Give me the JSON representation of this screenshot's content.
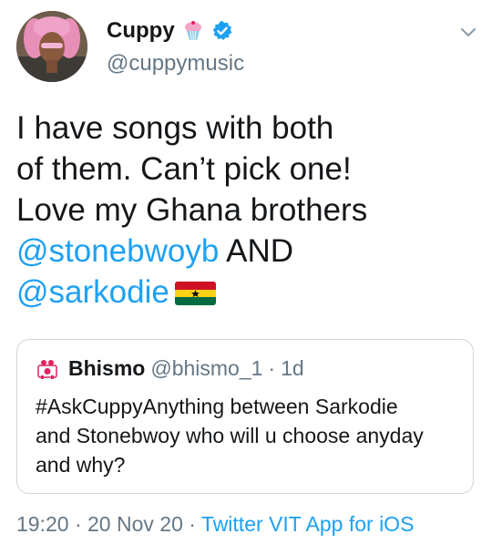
{
  "author": {
    "display_name": "Cuppy",
    "handle": "@cuppymusic",
    "badge_icon": "cupcake-icon",
    "verified_icon": "verified-badge-icon",
    "verified_color": "#1da1f2"
  },
  "tweet": {
    "line1": "I have songs with both",
    "line2": "of them. Can’t pick one!",
    "line3": "Love my Ghana brothers",
    "mention1": "@stonebwoyb",
    "and_text": "AND",
    "mention2": "@sarkodie",
    "flag_icon": "ghana-flag-icon"
  },
  "quote": {
    "name": "Bhismo",
    "handle": "@bhismo_1",
    "separator": "·",
    "time": "1d",
    "line1": "#AskCuppyAnything between Sarkodie",
    "line2": "and Stonebwoy who will u choose anyday",
    "line3": "and why?"
  },
  "footer": {
    "time": "19:20",
    "sep1": "·",
    "date": "20 Nov 20",
    "sep2": "·",
    "source": "Twitter VIT App for iOS"
  },
  "colors": {
    "text": "#14171a",
    "secondary": "#657786",
    "link": "#1da1f2",
    "border": "#ccd6dd"
  }
}
